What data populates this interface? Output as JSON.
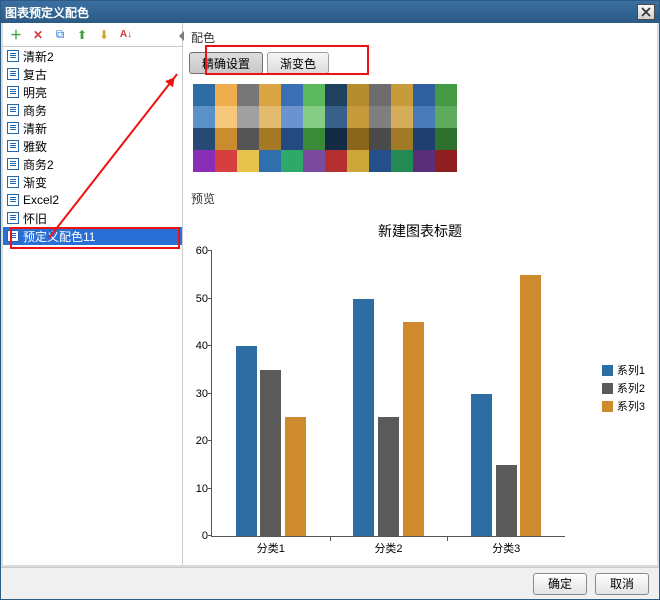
{
  "window_title": "图表预定义配色",
  "toolbar": {
    "add": "＋",
    "delete": "✕",
    "copy": "⧉",
    "up": "⬆",
    "down": "⬇",
    "sort": "A↓"
  },
  "list_items": [
    "清新2",
    "复古",
    "明亮",
    "商务",
    "清新",
    "雅致",
    "商务2",
    "渐变",
    "Excel2",
    "怀旧",
    "预定义配色11"
  ],
  "selected_index": 10,
  "section_color_label": "配色",
  "tab_precise": "精确设置",
  "tab_gradient": "渐变色",
  "palette": [
    [
      "#2e6da4",
      "#f0ad4e",
      "#777777",
      "#d9a441",
      "#3b6fb5",
      "#5cb85c",
      "#204060",
      "#b58c2e",
      "#6d6d6d",
      "#c79a3c",
      "#2f5f9e",
      "#449944"
    ],
    [
      "#5a91c8",
      "#f6c77a",
      "#a0a0a0",
      "#e2bc6c",
      "#6a93cf",
      "#85cc85",
      "#38608a",
      "#c79a3c",
      "#7f7f7f",
      "#d4ad58",
      "#4a7bb8",
      "#5eaa5e"
    ],
    [
      "#264a73",
      "#c98c2e",
      "#555555",
      "#a67a24",
      "#244a80",
      "#3a8a3a",
      "#122a44",
      "#8a661a",
      "#4a4a4a",
      "#a07a24",
      "#1e3f70",
      "#2e702e"
    ],
    [
      "#8a2eb7",
      "#d63f3f",
      "#e6c34a",
      "#2f6fae",
      "#2fa86a",
      "#7a4a9e",
      "#b52f2f",
      "#cda63a",
      "#244f8a",
      "#238a52",
      "#5a2f7a",
      "#8f1f1f"
    ]
  ],
  "preview_label": "预览",
  "chart_data": {
    "type": "bar",
    "title": "新建图表标题",
    "categories": [
      "分类1",
      "分类2",
      "分类3"
    ],
    "series": [
      {
        "name": "系列1",
        "color": "#2e6da4",
        "values": [
          40,
          50,
          30
        ]
      },
      {
        "name": "系列2",
        "color": "#5a5a5a",
        "values": [
          35,
          25,
          15
        ]
      },
      {
        "name": "系列3",
        "color": "#d08a2e",
        "values": [
          25,
          45,
          55
        ]
      }
    ],
    "yticks": [
      0,
      10,
      20,
      30,
      40,
      50,
      60
    ],
    "ylim": [
      0,
      60
    ]
  },
  "buttons": {
    "ok": "确定",
    "cancel": "取消"
  }
}
